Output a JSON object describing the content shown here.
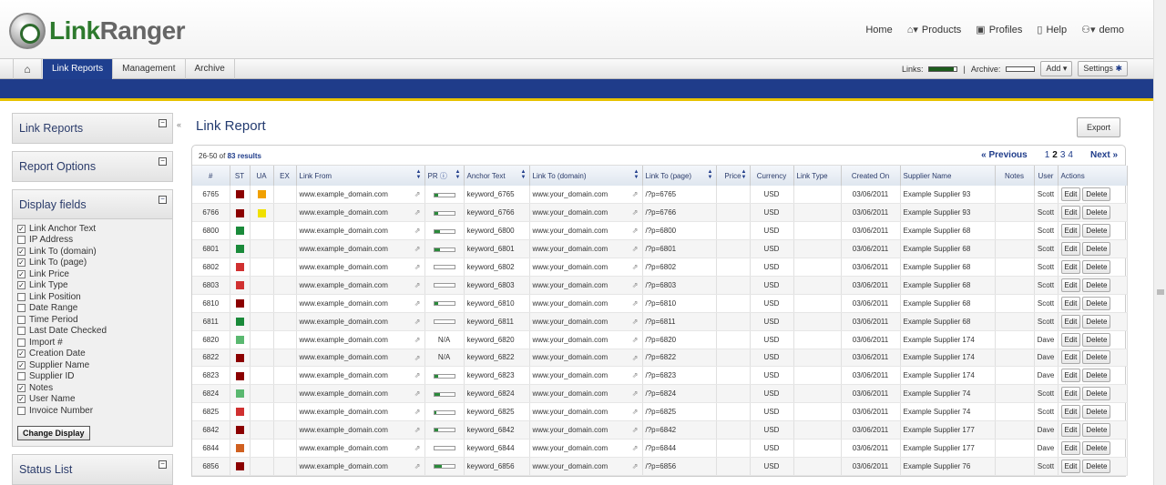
{
  "header": {
    "logo_text_a": "Link",
    "logo_text_b": "Ranger",
    "links": [
      {
        "label": "Home",
        "icon": ""
      },
      {
        "label": "Products",
        "icon": "home-dropdown-icon"
      },
      {
        "label": "Profiles",
        "icon": "profile-card-icon"
      },
      {
        "label": "Help",
        "icon": "help-book-icon"
      },
      {
        "label": "demo",
        "icon": "users-icon"
      }
    ]
  },
  "nav": {
    "tabs": [
      {
        "label": "Link Reports",
        "active": true
      },
      {
        "label": "Management",
        "active": false
      },
      {
        "label": "Archive",
        "active": false
      }
    ],
    "links_label": "Links:",
    "links_fill": 0.9,
    "separator": "|",
    "archive_label": "Archive:",
    "archive_fill": 0.0,
    "add_label": "Add",
    "settings_label": "Settings"
  },
  "sidebar": {
    "panels_top": [
      "Link Reports",
      "Report Options"
    ],
    "display_fields_title": "Display fields",
    "fields": [
      {
        "label": "Link Anchor Text",
        "checked": true
      },
      {
        "label": "IP Address",
        "checked": false
      },
      {
        "label": "Link To (domain)",
        "checked": true
      },
      {
        "label": "Link To (page)",
        "checked": true
      },
      {
        "label": "Link Price",
        "checked": true
      },
      {
        "label": "Link Type",
        "checked": true
      },
      {
        "label": "Link Position",
        "checked": false
      },
      {
        "label": "Date Range",
        "checked": false
      },
      {
        "label": "Time Period",
        "checked": false
      },
      {
        "label": "Last Date Checked",
        "checked": false
      },
      {
        "label": "Import #",
        "checked": false
      },
      {
        "label": "Creation Date",
        "checked": true
      },
      {
        "label": "Supplier Name",
        "checked": true
      },
      {
        "label": "Supplier ID",
        "checked": false
      },
      {
        "label": "Notes",
        "checked": true
      },
      {
        "label": "User Name",
        "checked": true
      },
      {
        "label": "Invoice Number",
        "checked": false
      }
    ],
    "change_display_label": "Change Display",
    "panels_bottom": [
      "Status List"
    ]
  },
  "main": {
    "title": "Link Report",
    "export_label": "Export",
    "results_prefix": "26-50 of",
    "results_count": "83 results",
    "pager": {
      "prev": "« Previous",
      "pages": [
        "1",
        "2",
        "3",
        "4"
      ],
      "current": "2",
      "next": "Next »"
    },
    "columns": [
      "#",
      "ST",
      "UA",
      "EX",
      "Link From",
      "PR",
      "Anchor Text",
      "Link To (domain)",
      "Link To (page)",
      "Price",
      "Currency",
      "Link Type",
      "Created On",
      "Supplier Name",
      "Notes",
      "User",
      "Actions"
    ],
    "edit_label": "Edit",
    "delete_label": "Delete",
    "rows": [
      {
        "id": "6765",
        "st": "#8b0000",
        "ua": "#f0a000",
        "from": "www.example_domain.com",
        "pr": 0.2,
        "anchor": "keyword_6765",
        "domain": "www.your_domain.com",
        "page": "/?p=6765",
        "currency": "USD",
        "created": "03/06/2011",
        "supplier": "Example Supplier 93",
        "user": "Scott"
      },
      {
        "id": "6766",
        "st": "#8b0000",
        "ua": "#f0e000",
        "from": "www.example_domain.com",
        "pr": 0.2,
        "anchor": "keyword_6766",
        "domain": "www.your_domain.com",
        "page": "/?p=6766",
        "currency": "USD",
        "created": "03/06/2011",
        "supplier": "Example Supplier 93",
        "user": "Scott"
      },
      {
        "id": "6800",
        "st": "#1a8a3a",
        "ua": "",
        "from": "www.example_domain.com",
        "pr": 0.3,
        "anchor": "keyword_6800",
        "domain": "www.your_domain.com",
        "page": "/?p=6800",
        "currency": "USD",
        "created": "03/06/2011",
        "supplier": "Example Supplier 68",
        "user": "Scott"
      },
      {
        "id": "6801",
        "st": "#1a8a3a",
        "ua": "",
        "from": "www.example_domain.com",
        "pr": 0.3,
        "anchor": "keyword_6801",
        "domain": "www.your_domain.com",
        "page": "/?p=6801",
        "currency": "USD",
        "created": "03/06/2011",
        "supplier": "Example Supplier 68",
        "user": "Scott"
      },
      {
        "id": "6802",
        "st": "#d03030",
        "ua": "",
        "from": "www.example_domain.com",
        "pr": 0.0,
        "anchor": "keyword_6802",
        "domain": "www.your_domain.com",
        "page": "/?p=6802",
        "currency": "USD",
        "created": "03/06/2011",
        "supplier": "Example Supplier 68",
        "user": "Scott"
      },
      {
        "id": "6803",
        "st": "#d03030",
        "ua": "",
        "from": "www.example_domain.com",
        "pr": 0.0,
        "anchor": "keyword_6803",
        "domain": "www.your_domain.com",
        "page": "/?p=6803",
        "currency": "USD",
        "created": "03/06/2011",
        "supplier": "Example Supplier 68",
        "user": "Scott"
      },
      {
        "id": "6810",
        "st": "#8b0000",
        "ua": "",
        "from": "www.example_domain.com",
        "pr": 0.2,
        "anchor": "keyword_6810",
        "domain": "www.your_domain.com",
        "page": "/?p=6810",
        "currency": "USD",
        "created": "03/06/2011",
        "supplier": "Example Supplier 68",
        "user": "Scott"
      },
      {
        "id": "6811",
        "st": "#1a8a3a",
        "ua": "",
        "from": "www.example_domain.com",
        "pr": 0.0,
        "anchor": "keyword_6811",
        "domain": "www.your_domain.com",
        "page": "/?p=6811",
        "currency": "USD",
        "created": "03/06/2011",
        "supplier": "Example Supplier 68",
        "user": "Scott"
      },
      {
        "id": "6820",
        "st": "#5ab870",
        "ua": "",
        "from": "www.example_domain.com",
        "pr": "N/A",
        "anchor": "keyword_6820",
        "domain": "www.your_domain.com",
        "page": "/?p=6820",
        "currency": "USD",
        "created": "03/06/2011",
        "supplier": "Example Supplier 174",
        "user": "Dave"
      },
      {
        "id": "6822",
        "st": "#8b0000",
        "ua": "",
        "from": "www.example_domain.com",
        "pr": "N/A",
        "anchor": "keyword_6822",
        "domain": "www.your_domain.com",
        "page": "/?p=6822",
        "currency": "USD",
        "created": "03/06/2011",
        "supplier": "Example Supplier 174",
        "user": "Dave"
      },
      {
        "id": "6823",
        "st": "#8b0000",
        "ua": "",
        "from": "www.example_domain.com",
        "pr": 0.2,
        "anchor": "keyword_6823",
        "domain": "www.your_domain.com",
        "page": "/?p=6823",
        "currency": "USD",
        "created": "03/06/2011",
        "supplier": "Example Supplier 174",
        "user": "Dave"
      },
      {
        "id": "6824",
        "st": "#5ab870",
        "ua": "",
        "from": "www.example_domain.com",
        "pr": 0.3,
        "anchor": "keyword_6824",
        "domain": "www.your_domain.com",
        "page": "/?p=6824",
        "currency": "USD",
        "created": "03/06/2011",
        "supplier": "Example Supplier 74",
        "user": "Scott"
      },
      {
        "id": "6825",
        "st": "#d03030",
        "ua": "",
        "from": "www.example_domain.com",
        "pr": 0.1,
        "anchor": "keyword_6825",
        "domain": "www.your_domain.com",
        "page": "/?p=6825",
        "currency": "USD",
        "created": "03/06/2011",
        "supplier": "Example Supplier 74",
        "user": "Scott"
      },
      {
        "id": "6842",
        "st": "#8b0000",
        "ua": "",
        "from": "www.example_domain.com",
        "pr": 0.2,
        "anchor": "keyword_6842",
        "domain": "www.your_domain.com",
        "page": "/?p=6842",
        "currency": "USD",
        "created": "03/06/2011",
        "supplier": "Example Supplier 177",
        "user": "Dave"
      },
      {
        "id": "6844",
        "st": "#d06020",
        "ua": "",
        "from": "www.example_domain.com",
        "pr": 0.0,
        "anchor": "keyword_6844",
        "domain": "www.your_domain.com",
        "page": "/?p=6844",
        "currency": "USD",
        "created": "03/06/2011",
        "supplier": "Example Supplier 177",
        "user": "Dave"
      },
      {
        "id": "6856",
        "st": "#8b0000",
        "ua": "",
        "from": "www.example_domain.com",
        "pr": 0.4,
        "anchor": "keyword_6856",
        "domain": "www.your_domain.com",
        "page": "/?p=6856",
        "currency": "USD",
        "created": "03/06/2011",
        "supplier": "Example Supplier 76",
        "user": "Scott"
      }
    ]
  }
}
